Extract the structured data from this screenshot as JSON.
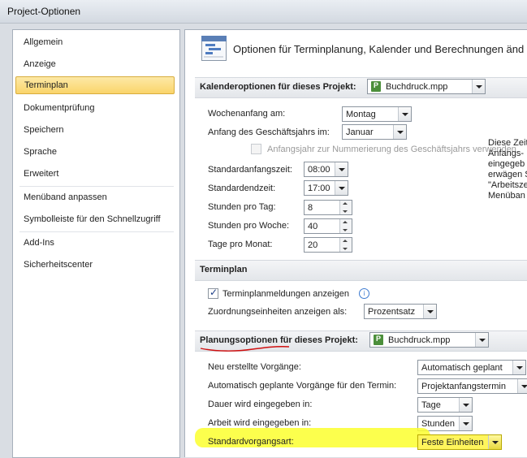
{
  "window": {
    "title": "Project-Optionen"
  },
  "sidebar": {
    "items": [
      {
        "label": "Allgemein"
      },
      {
        "label": "Anzeige"
      },
      {
        "label": "Terminplan",
        "selected": true
      },
      {
        "label": "Dokumentprüfung"
      },
      {
        "label": "Speichern"
      },
      {
        "label": "Sprache"
      },
      {
        "label": "Erweitert"
      },
      {
        "label": "Menüband anpassen"
      },
      {
        "label": "Symbolleiste für den Schnellzugriff"
      },
      {
        "label": "Add-Ins"
      },
      {
        "label": "Sicherheitscenter"
      }
    ]
  },
  "main": {
    "header": "Optionen für Terminplanung, Kalender und Berechnungen änd",
    "calendar": {
      "title": "Kalenderoptionen für dieses Projekt:",
      "project": "Buchdruck.mpp",
      "week_start_label": "Wochenanfang am:",
      "week_start_value": "Montag",
      "fiscal_year_label": "Anfang des Geschäftsjahrs im:",
      "fiscal_year_value": "Januar",
      "fiscal_numbering_label": "Anfangsjahr zur Nummerierung des Geschäftsjahrs verwenden",
      "default_start_label": "Standardanfangszeit:",
      "default_start_value": "08:00",
      "default_end_label": "Standardendzeit:",
      "default_end_value": "17:00",
      "hours_day_label": "Stunden pro Tag:",
      "hours_day_value": "8",
      "hours_week_label": "Stunden pro Woche:",
      "hours_week_value": "40",
      "days_month_label": "Tage pro Monat:",
      "days_month_value": "20",
      "note_lines": [
        "Diese Zeit",
        "Anfangs-",
        "eingegeb",
        "erwägen S",
        "\"Arbeitsze",
        "Menüban"
      ]
    },
    "schedule": {
      "title": "Terminplan",
      "show_messages_label": "Terminplanmeldungen anzeigen",
      "show_messages_checked": true,
      "assignment_units_label": "Zuordnungseinheiten anzeigen als:",
      "assignment_units_value": "Prozentsatz"
    },
    "planning": {
      "title": "Planungsoptionen für dieses Projekt:",
      "project": "Buchdruck.mpp",
      "new_tasks_label": "Neu erstellte Vorgänge:",
      "new_tasks_value": "Automatisch geplant",
      "auto_tasks_label": "Automatisch geplante Vorgänge für den Termin:",
      "auto_tasks_value": "Projektanfangstermin",
      "duration_label": "Dauer wird eingegeben in:",
      "duration_value": "Tage",
      "work_label": "Arbeit wird eingegeben in:",
      "work_value": "Stunden",
      "task_type_label": "Standardvorgangsart:",
      "task_type_value": "Feste Einheiten"
    }
  },
  "colors": {
    "selected_nav": "#fad46a",
    "highlighter": "#fbff2e",
    "red_annotation": "#d01010"
  }
}
